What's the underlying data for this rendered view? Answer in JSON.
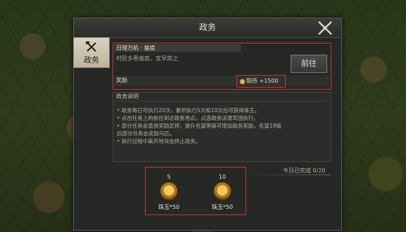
{
  "window": {
    "title": "政务"
  },
  "side_tab": {
    "label": "政务",
    "icon": "tools-icon"
  },
  "task": {
    "header": "日理万机 · 瘟疫",
    "description": "村民多患瘟疫，宜早禁之",
    "go_label": "前往",
    "reward_label": "奖励",
    "reward_value": "铜币 +1500"
  },
  "explanation": {
    "title": "政务说明",
    "items": [
      "• 政务每日可执行20次，累积执行5次和10次后可获得珠玉。",
      "• 点击任务上的前往到达政务地点，点选政务派遣军团执行。",
      "• 部分任务会直接奖励武将，提升名望等级可增加政务奖励，名望18级",
      "  后部分任务会奖励马匹。",
      "• 执行过程中离开地块会终止政务。"
    ]
  },
  "progress": {
    "text": "今日已完成 0/20"
  },
  "chests": [
    {
      "count": "5",
      "label": "珠玉*50"
    },
    {
      "count": "10",
      "label": "珠玉*50"
    }
  ],
  "colors": {
    "highlight": "#c7363b",
    "panel": "#262826"
  }
}
